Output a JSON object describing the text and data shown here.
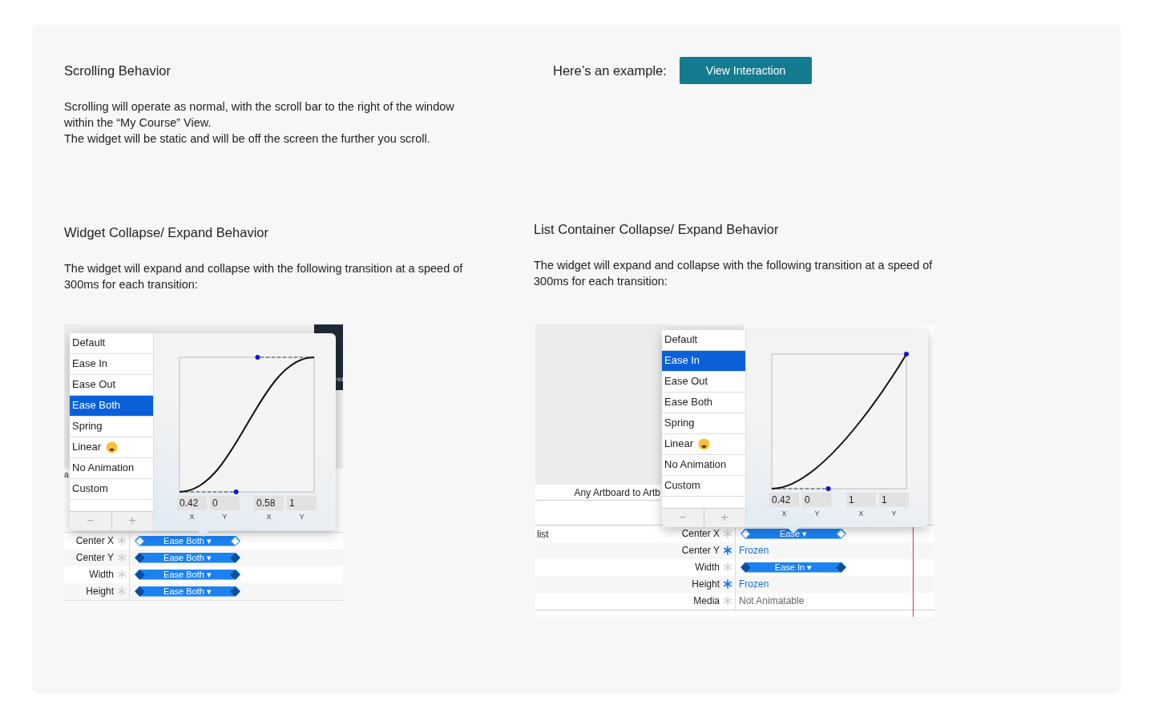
{
  "scrolling": {
    "title": "Scrolling Behavior",
    "paragraphs": [
      "Scrolling will operate as normal, with the scroll bar to the right of the window within the “My Course” View.",
      "The widget will be static and will be off the screen the further you scroll."
    ]
  },
  "example": {
    "label": "Here’s an example:",
    "button": "View Interaction"
  },
  "sections": [
    {
      "title": "Widget Collapse/ Expand Behavior",
      "paragraph": "The widget will expand and collapse with the following transition at a speed of 300ms for each transition:",
      "screenshot": {
        "kind": "widget",
        "panel_text": "Hid",
        "edge_text": "a",
        "menu": [
          {
            "label": "Default",
            "selected": false
          },
          {
            "label": "Ease In",
            "selected": false
          },
          {
            "label": "Ease Out",
            "selected": false
          },
          {
            "label": "Ease Both",
            "selected": true
          },
          {
            "label": "Spring",
            "selected": false
          },
          {
            "label": "Linear",
            "selected": false,
            "kind": "emoji"
          },
          {
            "label": "No Animation",
            "selected": false
          },
          {
            "label": "Custom",
            "selected": false
          }
        ],
        "footer_buttons": [
          "−",
          "+"
        ],
        "fields": [
          {
            "value": "0.42",
            "axis": "X"
          },
          {
            "value": "0",
            "axis": "Y"
          },
          {
            "value": "0.58",
            "axis": "X"
          },
          {
            "value": "1",
            "axis": "Y"
          }
        ],
        "rows": [
          {
            "name": "Center X",
            "frozen": false,
            "kind": "transition",
            "value": "Ease Both",
            "caret": "▾",
            "selected": true
          },
          {
            "name": "Center Y",
            "frozen": false,
            "kind": "transition",
            "value": "Ease Both",
            "caret": "▾",
            "selected": false
          },
          {
            "name": "Width",
            "frozen": false,
            "kind": "transition",
            "value": "Ease Both",
            "caret": "▾",
            "selected": false
          },
          {
            "name": "Height",
            "frozen": false,
            "kind": "transition",
            "value": "Ease Both",
            "caret": "▾",
            "selected": false
          }
        ]
      }
    },
    {
      "title": "List Container Collapse/ Expand Behavior",
      "paragraph": "The widget will expand and collapse with the following transition at a speed of 300ms for each transition:",
      "screenshot": {
        "kind": "list_container",
        "band_text": "Any Artboard to Artb",
        "group_label": "list",
        "menu": [
          {
            "label": "Default",
            "selected": false
          },
          {
            "label": "Ease In",
            "selected": true
          },
          {
            "label": "Ease Out",
            "selected": false
          },
          {
            "label": "Ease Both",
            "selected": false
          },
          {
            "label": "Spring",
            "selected": false
          },
          {
            "label": "Linear",
            "selected": false,
            "kind": "emoji"
          },
          {
            "label": "No Animation",
            "selected": false
          },
          {
            "label": "Custom",
            "selected": false
          }
        ],
        "footer_buttons": [
          "−",
          "+"
        ],
        "fields": [
          {
            "value": "0.42",
            "axis": "X"
          },
          {
            "value": "0",
            "axis": "Y"
          },
          {
            "value": "1",
            "axis": "X"
          },
          {
            "value": "1",
            "axis": "Y"
          }
        ],
        "rows": [
          {
            "name": "Center X",
            "frozen": false,
            "kind": "transition",
            "value": "Ease",
            "caret": "▾",
            "selected": true
          },
          {
            "name": "Center Y",
            "frozen": true,
            "kind": "frozen",
            "value": "Frozen"
          },
          {
            "name": "Width",
            "frozen": false,
            "kind": "transition",
            "value": "Ease In",
            "caret": "▾",
            "selected": false
          },
          {
            "name": "Height",
            "frozen": true,
            "kind": "frozen",
            "value": "Frozen"
          },
          {
            "name": "Media",
            "frozen": false,
            "kind": "static",
            "value": "Not Animatable"
          }
        ]
      }
    }
  ]
}
